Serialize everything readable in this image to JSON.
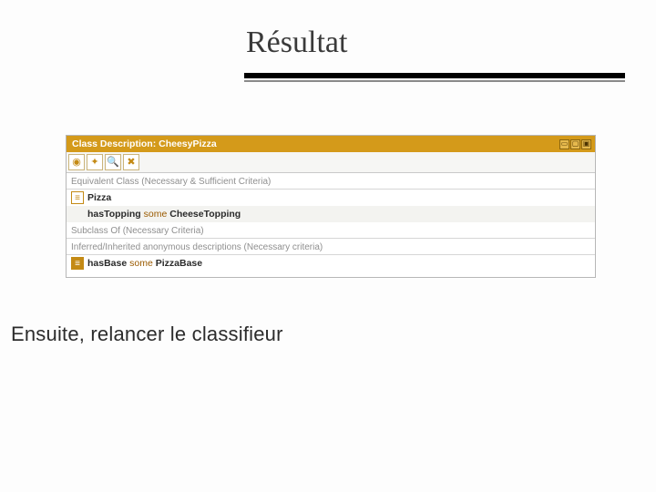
{
  "title": "Résultat",
  "panel": {
    "header_prefix": "Class Description:",
    "header_class": "CheesyPizza",
    "sections": {
      "equivalent": "Equivalent Class (Necessary & Sufficient Criteria)",
      "subclass": "Subclass Of (Necessary Criteria)",
      "inferred": "Inferred/Inherited anonymous descriptions (Necessary criteria)"
    },
    "equivalent_rows": [
      {
        "text_class": "Pizza"
      },
      {
        "prop": "hasTopping",
        "kw": "some",
        "cls": "CheeseTopping"
      }
    ],
    "inferred_rows": [
      {
        "prop": "hasBase",
        "kw": "some",
        "cls": "PizzaBase"
      }
    ],
    "toolbar_icons": {
      "a": "◉",
      "b": "✦",
      "c": "🔍",
      "d": "✖"
    },
    "winbtns": {
      "min": "▭",
      "max": "▢",
      "close": "▣"
    }
  },
  "caption": "Ensuite, relancer le classifieur"
}
